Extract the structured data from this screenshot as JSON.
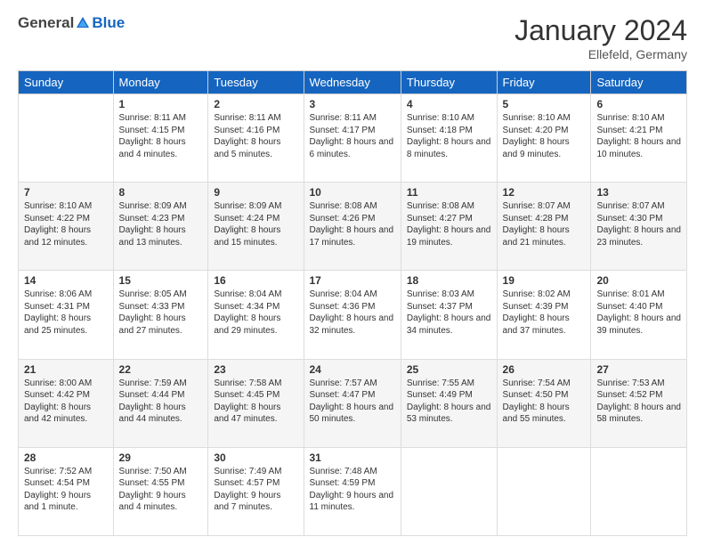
{
  "logo": {
    "general": "General",
    "blue": "Blue"
  },
  "title": "January 2024",
  "location": "Ellefeld, Germany",
  "days": [
    "Sunday",
    "Monday",
    "Tuesday",
    "Wednesday",
    "Thursday",
    "Friday",
    "Saturday"
  ],
  "weeks": [
    [
      {
        "day": "",
        "sunrise": "",
        "sunset": "",
        "daylight": ""
      },
      {
        "day": "1",
        "sunrise": "Sunrise: 8:11 AM",
        "sunset": "Sunset: 4:15 PM",
        "daylight": "Daylight: 8 hours and 4 minutes."
      },
      {
        "day": "2",
        "sunrise": "Sunrise: 8:11 AM",
        "sunset": "Sunset: 4:16 PM",
        "daylight": "Daylight: 8 hours and 5 minutes."
      },
      {
        "day": "3",
        "sunrise": "Sunrise: 8:11 AM",
        "sunset": "Sunset: 4:17 PM",
        "daylight": "Daylight: 8 hours and 6 minutes."
      },
      {
        "day": "4",
        "sunrise": "Sunrise: 8:10 AM",
        "sunset": "Sunset: 4:18 PM",
        "daylight": "Daylight: 8 hours and 8 minutes."
      },
      {
        "day": "5",
        "sunrise": "Sunrise: 8:10 AM",
        "sunset": "Sunset: 4:20 PM",
        "daylight": "Daylight: 8 hours and 9 minutes."
      },
      {
        "day": "6",
        "sunrise": "Sunrise: 8:10 AM",
        "sunset": "Sunset: 4:21 PM",
        "daylight": "Daylight: 8 hours and 10 minutes."
      }
    ],
    [
      {
        "day": "7",
        "sunrise": "Sunrise: 8:10 AM",
        "sunset": "Sunset: 4:22 PM",
        "daylight": "Daylight: 8 hours and 12 minutes."
      },
      {
        "day": "8",
        "sunrise": "Sunrise: 8:09 AM",
        "sunset": "Sunset: 4:23 PM",
        "daylight": "Daylight: 8 hours and 13 minutes."
      },
      {
        "day": "9",
        "sunrise": "Sunrise: 8:09 AM",
        "sunset": "Sunset: 4:24 PM",
        "daylight": "Daylight: 8 hours and 15 minutes."
      },
      {
        "day": "10",
        "sunrise": "Sunrise: 8:08 AM",
        "sunset": "Sunset: 4:26 PM",
        "daylight": "Daylight: 8 hours and 17 minutes."
      },
      {
        "day": "11",
        "sunrise": "Sunrise: 8:08 AM",
        "sunset": "Sunset: 4:27 PM",
        "daylight": "Daylight: 8 hours and 19 minutes."
      },
      {
        "day": "12",
        "sunrise": "Sunrise: 8:07 AM",
        "sunset": "Sunset: 4:28 PM",
        "daylight": "Daylight: 8 hours and 21 minutes."
      },
      {
        "day": "13",
        "sunrise": "Sunrise: 8:07 AM",
        "sunset": "Sunset: 4:30 PM",
        "daylight": "Daylight: 8 hours and 23 minutes."
      }
    ],
    [
      {
        "day": "14",
        "sunrise": "Sunrise: 8:06 AM",
        "sunset": "Sunset: 4:31 PM",
        "daylight": "Daylight: 8 hours and 25 minutes."
      },
      {
        "day": "15",
        "sunrise": "Sunrise: 8:05 AM",
        "sunset": "Sunset: 4:33 PM",
        "daylight": "Daylight: 8 hours and 27 minutes."
      },
      {
        "day": "16",
        "sunrise": "Sunrise: 8:04 AM",
        "sunset": "Sunset: 4:34 PM",
        "daylight": "Daylight: 8 hours and 29 minutes."
      },
      {
        "day": "17",
        "sunrise": "Sunrise: 8:04 AM",
        "sunset": "Sunset: 4:36 PM",
        "daylight": "Daylight: 8 hours and 32 minutes."
      },
      {
        "day": "18",
        "sunrise": "Sunrise: 8:03 AM",
        "sunset": "Sunset: 4:37 PM",
        "daylight": "Daylight: 8 hours and 34 minutes."
      },
      {
        "day": "19",
        "sunrise": "Sunrise: 8:02 AM",
        "sunset": "Sunset: 4:39 PM",
        "daylight": "Daylight: 8 hours and 37 minutes."
      },
      {
        "day": "20",
        "sunrise": "Sunrise: 8:01 AM",
        "sunset": "Sunset: 4:40 PM",
        "daylight": "Daylight: 8 hours and 39 minutes."
      }
    ],
    [
      {
        "day": "21",
        "sunrise": "Sunrise: 8:00 AM",
        "sunset": "Sunset: 4:42 PM",
        "daylight": "Daylight: 8 hours and 42 minutes."
      },
      {
        "day": "22",
        "sunrise": "Sunrise: 7:59 AM",
        "sunset": "Sunset: 4:44 PM",
        "daylight": "Daylight: 8 hours and 44 minutes."
      },
      {
        "day": "23",
        "sunrise": "Sunrise: 7:58 AM",
        "sunset": "Sunset: 4:45 PM",
        "daylight": "Daylight: 8 hours and 47 minutes."
      },
      {
        "day": "24",
        "sunrise": "Sunrise: 7:57 AM",
        "sunset": "Sunset: 4:47 PM",
        "daylight": "Daylight: 8 hours and 50 minutes."
      },
      {
        "day": "25",
        "sunrise": "Sunrise: 7:55 AM",
        "sunset": "Sunset: 4:49 PM",
        "daylight": "Daylight: 8 hours and 53 minutes."
      },
      {
        "day": "26",
        "sunrise": "Sunrise: 7:54 AM",
        "sunset": "Sunset: 4:50 PM",
        "daylight": "Daylight: 8 hours and 55 minutes."
      },
      {
        "day": "27",
        "sunrise": "Sunrise: 7:53 AM",
        "sunset": "Sunset: 4:52 PM",
        "daylight": "Daylight: 8 hours and 58 minutes."
      }
    ],
    [
      {
        "day": "28",
        "sunrise": "Sunrise: 7:52 AM",
        "sunset": "Sunset: 4:54 PM",
        "daylight": "Daylight: 9 hours and 1 minute."
      },
      {
        "day": "29",
        "sunrise": "Sunrise: 7:50 AM",
        "sunset": "Sunset: 4:55 PM",
        "daylight": "Daylight: 9 hours and 4 minutes."
      },
      {
        "day": "30",
        "sunrise": "Sunrise: 7:49 AM",
        "sunset": "Sunset: 4:57 PM",
        "daylight": "Daylight: 9 hours and 7 minutes."
      },
      {
        "day": "31",
        "sunrise": "Sunrise: 7:48 AM",
        "sunset": "Sunset: 4:59 PM",
        "daylight": "Daylight: 9 hours and 11 minutes."
      },
      {
        "day": "",
        "sunrise": "",
        "sunset": "",
        "daylight": ""
      },
      {
        "day": "",
        "sunrise": "",
        "sunset": "",
        "daylight": ""
      },
      {
        "day": "",
        "sunrise": "",
        "sunset": "",
        "daylight": ""
      }
    ]
  ]
}
